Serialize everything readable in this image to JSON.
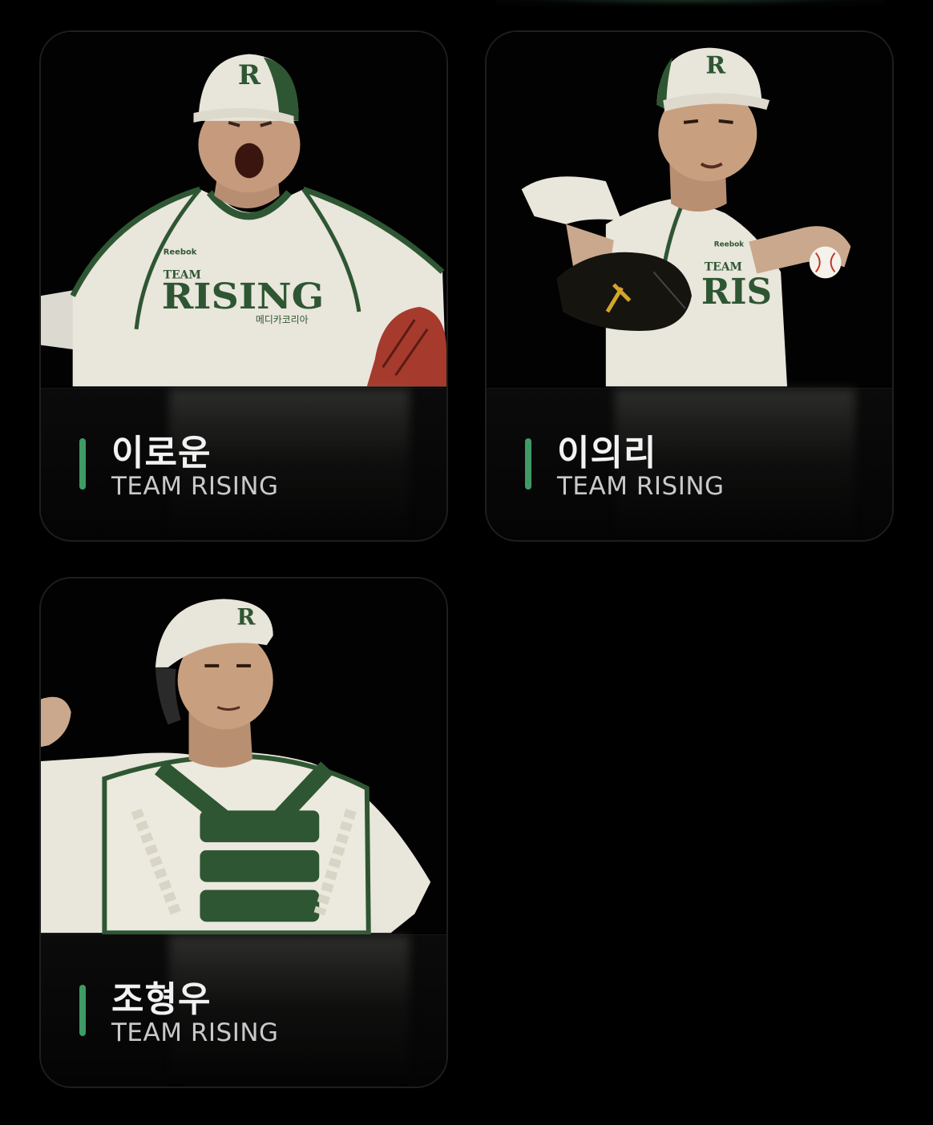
{
  "players": [
    {
      "name": "이로운",
      "team": "TEAM RISING",
      "photo": "player-photo-pitcher-shouting"
    },
    {
      "name": "이의리",
      "team": "TEAM RISING",
      "photo": "player-photo-pitcher-throwing"
    },
    {
      "name": "조형우",
      "team": "TEAM RISING",
      "photo": "player-photo-catcher"
    }
  ],
  "jersey": {
    "cap_letter": "R",
    "chest_top": "TEAM",
    "chest_main": "RISING",
    "chest_main_partial": "RIS",
    "sponsor": "메디카코리아",
    "brand": "Reebok"
  },
  "colors": {
    "background": "#000000",
    "card_border": "#1e1e1e",
    "accent": "#3f9a66",
    "jersey_white": "#e9e6dc",
    "jersey_green": "#2e5632",
    "glove_red": "#a63a2c"
  }
}
